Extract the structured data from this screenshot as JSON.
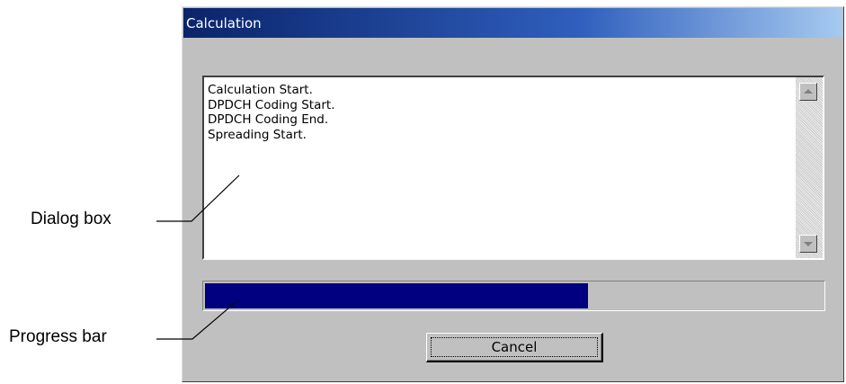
{
  "window": {
    "title": "Calculation"
  },
  "log": {
    "lines": [
      "Calculation Start.",
      "DPDCH Coding Start.",
      "DPDCH Coding End.",
      "Spreading Start."
    ]
  },
  "progress": {
    "fraction": 0.62
  },
  "buttons": {
    "cancel_label": "Cancel"
  },
  "annotations": {
    "dialog_box": "Dialog  box",
    "progress_bar": "Progress  bar"
  },
  "colors": {
    "titlebar_start": "#0a246a",
    "progress_fill": "#000080",
    "window_bg": "#c0c0c0"
  }
}
